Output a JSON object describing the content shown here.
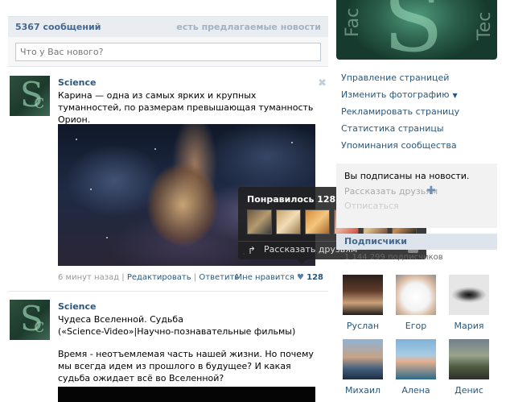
{
  "feed": {
    "count_label": "5367 сообщений",
    "suggested_label": "есть предлагаемые новости",
    "composer_placeholder": "Что у Вас нового?"
  },
  "posts": [
    {
      "author": "Science",
      "text": "Карина — одна из самых ярких и крупных туманностей, по размерам превышающая туманность Орион.",
      "time": "6 минут назад",
      "edit_label": "Редактировать",
      "reply_label": "Ответить",
      "like_label": "Мне нравится",
      "like_count": "128"
    },
    {
      "author": "Science",
      "text_line1": "Чудеса Вселенной. Судьба",
      "text_line2": "(«Science-Video»|Научно-познавательные фильмы)",
      "text_line3": "Время - неотъемлемая часть нашей жизни. Но почему мы всегда идем из прошлого в будущее? И какая судьба ожидает всё во Вселенной?"
    }
  ],
  "tooltip": {
    "title": "Понравилось 128 людям",
    "share_label": "Рассказать друзьям"
  },
  "sidebar": {
    "menu": [
      "Управление страницей",
      "Изменить фотографию",
      "Рекламировать страницу",
      "Статистика страницы",
      "Упоминания сообщества"
    ],
    "subscribed_text": "Вы подписаны на новости.",
    "tell_friends": "Рассказать друзьям",
    "unsubscribe": "Отписаться",
    "subscribers_title": "Подписчики",
    "subscribers_count": "1 144 299 подписчиков",
    "subscribers": [
      "Руслан",
      "Егор",
      "Мария",
      "Михаил",
      "Алена",
      "Денис"
    ]
  },
  "colors": {
    "link": "#2b587a",
    "header_bg": "#e9edf1",
    "tooltip_bg": "#202020"
  }
}
